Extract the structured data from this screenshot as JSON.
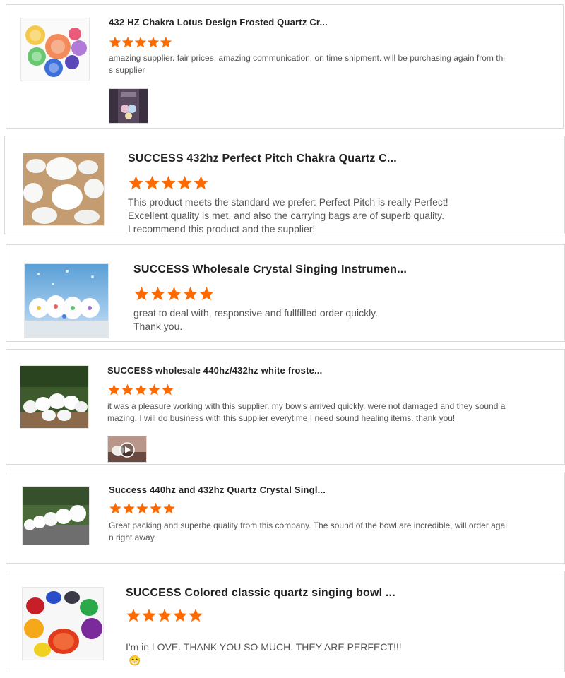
{
  "colors": {
    "star": "#ff6a00",
    "border": "#d9d9d9",
    "title": "#222222",
    "comment": "#555555"
  },
  "reviews": [
    {
      "title": "432 HZ Chakra Lotus Design Frosted Quartz Cr...",
      "rating": 5,
      "comment": "amazing supplier. fair prices, amazing communication, on time shipment. will be purchasing again from thi\ns supplier",
      "product_image": "colored-chakra-bowls-image",
      "has_attachment": true,
      "attachment_type": "photo"
    },
    {
      "title": "SUCCESS 432hz Perfect Pitch Chakra Quartz C...",
      "rating": 5,
      "comment": "This product meets the standard we prefer: Perfect Pitch is really Perfect!\nExcellent quality is met, and also the carrying bags are of superb quality.\nI recommend this product and the supplier!",
      "product_image": "white-frosted-bowls-image",
      "has_attachment": false
    },
    {
      "title": "SUCCESS Wholesale Crystal Singing Instrumen...",
      "rating": 5,
      "comment": "great to deal with, responsive and fullfilled order quickly.\nThank you.",
      "product_image": "bowls-on-blue-background-image",
      "has_attachment": false
    },
    {
      "title": "SUCCESS wholesale 440hz/432hz white froste...",
      "rating": 5,
      "comment": "it was a pleasure working with this supplier. my bowls arrived quickly, were not damaged and they sound a\nmazing. I will do business with this supplier everytime I need sound healing items. thank you!",
      "product_image": "white-bowls-outdoor-image",
      "has_attachment": true,
      "attachment_type": "video"
    },
    {
      "title": "Success 440hz and 432hz Quartz Crystal Singl...",
      "rating": 5,
      "comment": "Great packing and superbe quality from this company. The sound of the bowl are incredible, will order agai\nn right away.",
      "product_image": "bowls-row-outdoor-image",
      "has_attachment": false
    },
    {
      "title": "SUCCESS Colored classic quartz singing bowl ...",
      "rating": 5,
      "comment": "I'm in LOVE. THANK YOU SO MUCH. THEY ARE PERFECT!!!",
      "emoji": "😁",
      "product_image": "colored-classic-bowls-image",
      "has_attachment": false
    }
  ]
}
